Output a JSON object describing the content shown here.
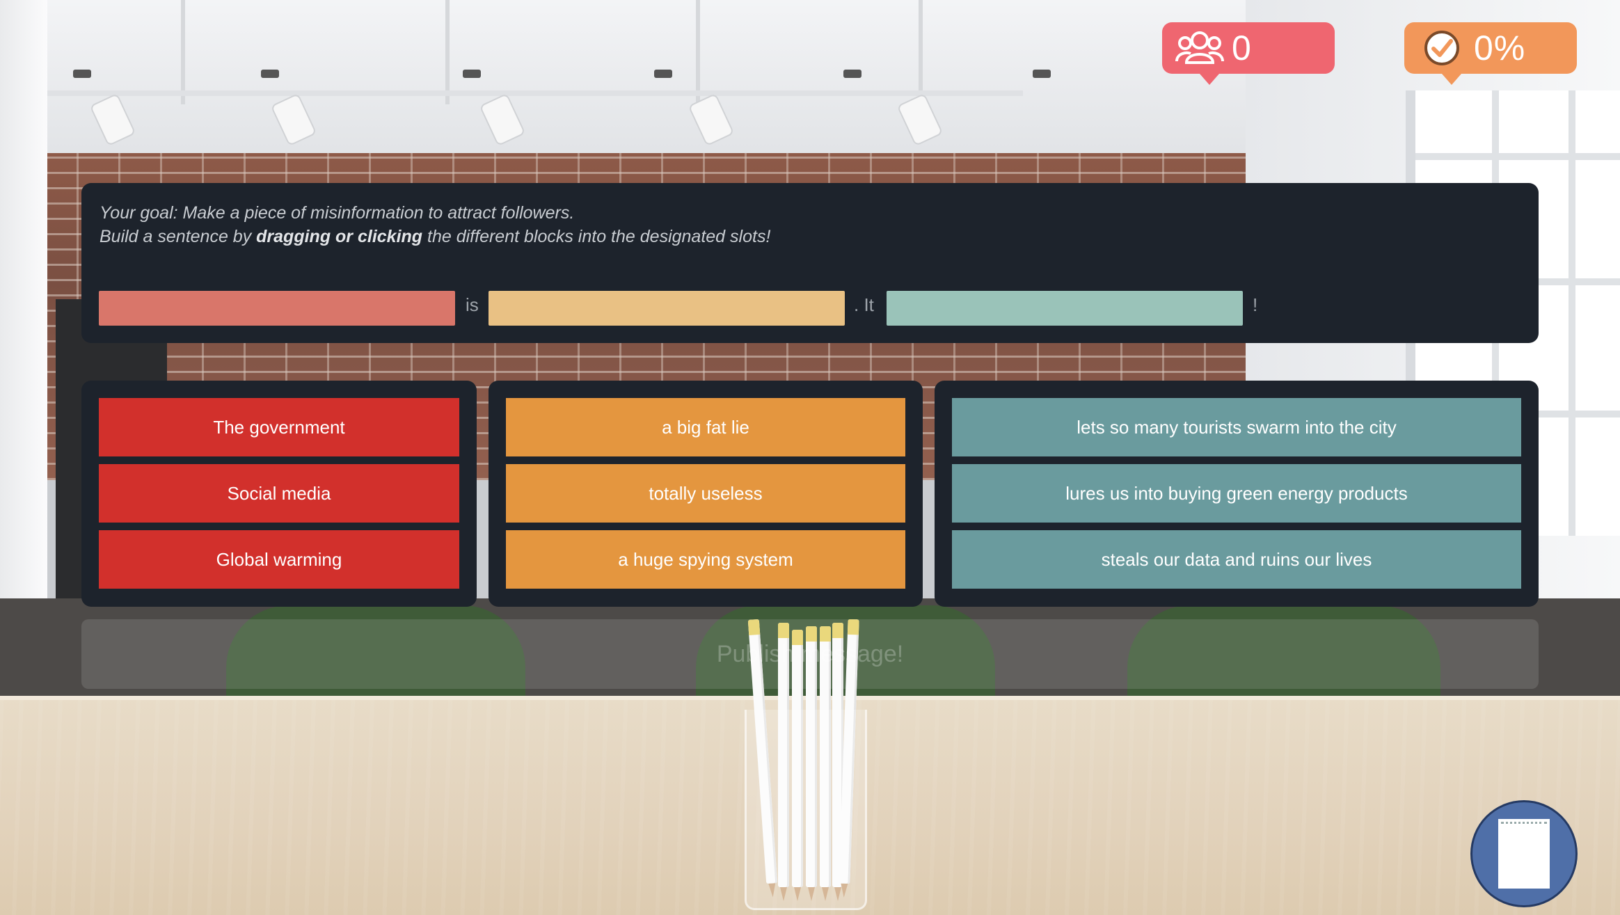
{
  "stats": {
    "followers_value": "0",
    "followers_icon": "users-icon",
    "score_value": "0%",
    "score_icon": "check-circle-icon"
  },
  "goal": {
    "line1": "Your goal: Make a piece of misinformation to attract followers.",
    "line2_prefix": "Build a sentence by ",
    "line2_bold": "dragging or clicking",
    "line2_suffix": " the different blocks into the designated slots!"
  },
  "sentence": {
    "joiner_1": "is",
    "joiner_2": ". It",
    "joiner_3": "!"
  },
  "columns": {
    "subjects": [
      "The government",
      "Social media",
      "Global warming"
    ],
    "descriptions": [
      "a big fat lie",
      "totally useless",
      "a huge spying system"
    ],
    "actions": [
      "lets so many tourists swarm into the city",
      "lures us into buying green energy products",
      "steals our data and ruins our lives"
    ]
  },
  "publish_label": "Publish message!",
  "notebook_icon": "notebook-icon",
  "colors": {
    "subject": "#d2302c",
    "description": "#e4963f",
    "action": "#6a9b9e",
    "slot_subject": "#d9766a",
    "slot_description": "#e9c184",
    "slot_action": "#9ac3b9",
    "panel": "#1d232c",
    "followers_badge": "#ef6670",
    "score_badge": "#f2975a"
  }
}
